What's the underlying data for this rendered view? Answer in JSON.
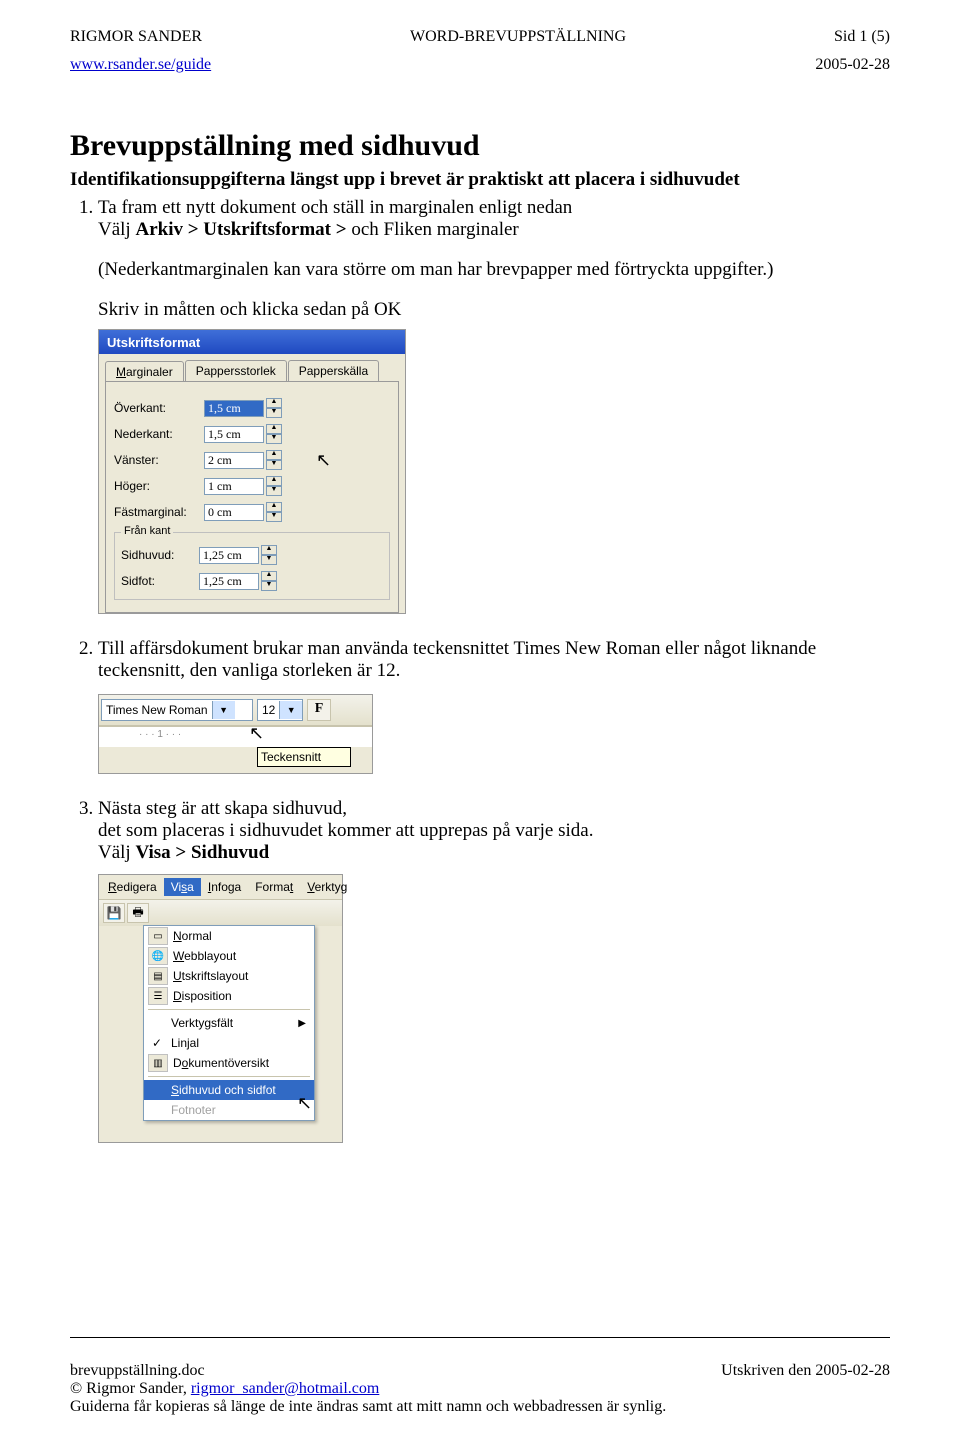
{
  "header": {
    "left": "RIGMOR SANDER",
    "center": "WORD-BREVUPPSTÄLLNING",
    "right": "Sid 1 (5)",
    "url": "www.rsander.se/guide",
    "date": "2005-02-28"
  },
  "title": "Brevuppställning med sidhuvud",
  "intro": "Identifikationsuppgifterna längst upp i brevet är praktiskt att placera i sidhuvudet",
  "li1_a": "Ta fram ett nytt dokument och ställ in marginalen enligt nedan",
  "li1_b": "Välj ",
  "li1_c": "Arkiv > Utskriftsformat >",
  "li1_d": " och Fliken marginaler",
  "note": "(Nederkantmarginalen kan vara större om man har brevpapper med förtryckta uppgifter.)",
  "skriv": "Skriv in måtten och klicka sedan på OK",
  "dialog": {
    "title": "Utskriftsformat",
    "tabs": [
      "Marginaler",
      "Pappersstorlek",
      "Papperskälla"
    ],
    "fields": {
      "overkant": {
        "label": "Överkant:",
        "value": "1,5 cm"
      },
      "nederkant": {
        "label": "Nederkant:",
        "value": "1,5 cm"
      },
      "vanster": {
        "label": "Vänster:",
        "value": "2 cm"
      },
      "hoger": {
        "label": "Höger:",
        "value": "1 cm"
      },
      "fast": {
        "label": "Fästmarginal:",
        "value": "0 cm"
      }
    },
    "grp": "Från kant",
    "sidhuvud": {
      "label": "Sidhuvud:",
      "value": "1,25 cm"
    },
    "sidfot": {
      "label": "Sidfot:",
      "value": "1,25 cm"
    }
  },
  "li2": "Till affärsdokument brukar man använda teckensnittet Times New Roman eller något liknande teckensnitt, den vanliga storleken är 12.",
  "fontbar": {
    "font": "Times New Roman",
    "size": "12",
    "tooltip": "Teckensnitt"
  },
  "li3_a": "Nästa steg är att skapa sidhuvud,",
  "li3_b": "det som placeras i sidhuvudet kommer att upprepas på varje sida.",
  "li3_c": "Välj ",
  "li3_d": "Visa > Sidhuvud",
  "menu": {
    "bar": [
      "Redigera",
      "Visa",
      "Infoga",
      "Format",
      "Verktyg"
    ],
    "items": {
      "normal": "Normal",
      "webb": "Webblayout",
      "utskrift": "Utskriftslayout",
      "disp": "Disposition",
      "verktyg": "Verktygsfält",
      "linjal": "Linjal",
      "dok": "Dokumentöversikt",
      "sid": "Sidhuvud och sidfot",
      "fot": "Fotnoter"
    }
  },
  "footer": {
    "file": "brevuppställning.doc",
    "printed": "Utskriven den 2005-02-28",
    "copy": "© Rigmor Sander, ",
    "email": "rigmor_sander@hotmail.com",
    "disclaimer": "Guiderna får kopieras så länge de inte ändras samt att mitt namn och webbadressen är synlig."
  }
}
